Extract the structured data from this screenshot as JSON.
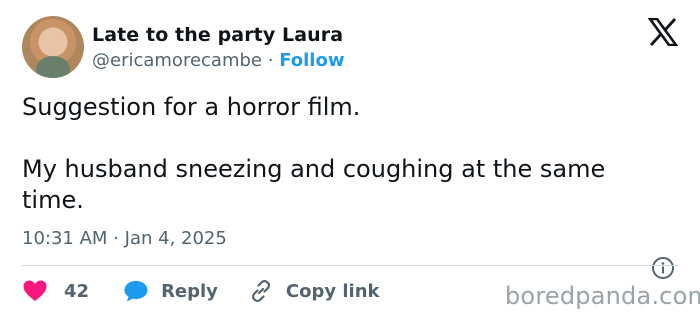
{
  "author": {
    "display_name": "Late to the party Laura",
    "handle": "@ericamorecambe",
    "separator": "·",
    "follow_label": "Follow"
  },
  "tweet": {
    "paragraphs": [
      "Suggestion for a horror film.",
      "My husband sneezing and coughing at the same time."
    ],
    "time": "10:31 AM",
    "date_separator": "·",
    "date": "Jan 4, 2025"
  },
  "actions": {
    "likes": "42",
    "reply_label": "Reply",
    "copy_label": "Copy link"
  },
  "watermark": "boredpanda.com",
  "icons": {
    "brand": "x-logo-icon",
    "info": "info-icon",
    "like": "heart-icon",
    "reply": "reply-bubble-icon",
    "copy": "link-icon"
  },
  "colors": {
    "heart": "#f91880",
    "reply": "#1d9bf0",
    "follow": "#1d9bf0",
    "secondary_text": "#536471"
  }
}
